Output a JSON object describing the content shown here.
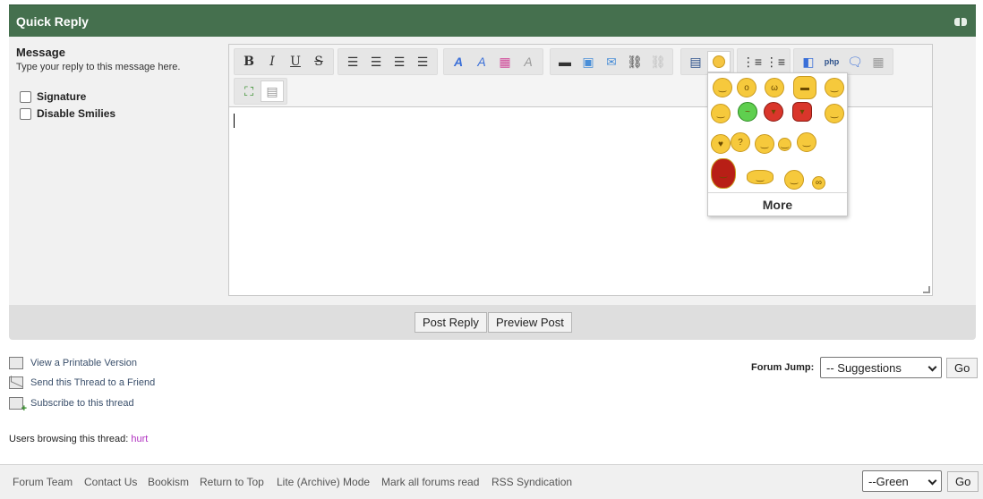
{
  "quick_reply": {
    "title": "Quick Reply",
    "message_label": "Message",
    "message_desc": "Type your reply to this message here.",
    "options": [
      "Signature",
      "Disable Smilies"
    ],
    "smilies_more": "More",
    "post_reply": "Post Reply",
    "preview_post": "Preview Post"
  },
  "toolbar": {
    "format": [
      "B",
      "I",
      "U",
      "S"
    ],
    "icons": [
      "align-left-icon",
      "align-center-icon",
      "align-right-icon",
      "justify-icon",
      "font-icon",
      "font-size-icon",
      "color-icon",
      "remove-format-icon",
      "horizontal-rule-icon",
      "image-icon",
      "email-icon",
      "link-icon",
      "unlink-icon",
      "video-icon",
      "smiley-icon",
      "bullet-list-icon",
      "numbered-list-icon",
      "code-icon",
      "php-icon",
      "quote-icon",
      "source-icon",
      "expand-icon",
      "source-mode-icon"
    ]
  },
  "thread_tools": [
    {
      "label": "View a Printable Version",
      "icon": "printer-icon"
    },
    {
      "label": "Send this Thread to a Friend",
      "icon": "envelope-icon"
    },
    {
      "label": "Subscribe to this thread",
      "icon": "subscribe-icon"
    }
  ],
  "forum_jump": {
    "label": "Forum Jump:",
    "selected": "-- Suggestions",
    "go": "Go"
  },
  "browsing": {
    "label": "Users browsing this thread:",
    "users": "hurt"
  },
  "footer": {
    "links": [
      "Forum Team",
      "Contact Us",
      "Bookism",
      "Return to Top",
      "Lite (Archive) Mode",
      "Mark all forums read",
      "RSS Syndication"
    ],
    "theme_selected": "--Green",
    "go": "Go"
  }
}
